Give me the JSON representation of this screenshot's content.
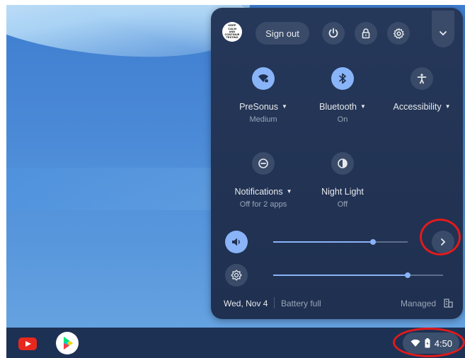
{
  "system_tray": {
    "avatar_text": [
      "KEEP",
      "CALM",
      "AND",
      "CONTINUE",
      "TESTING"
    ],
    "sign_out_label": "Sign out",
    "tiles": [
      {
        "label": "PreSonus",
        "sublabel": "Medium",
        "icon": "wifi-lock-icon",
        "active": true,
        "has_menu": true
      },
      {
        "label": "Bluetooth",
        "sublabel": "On",
        "icon": "bluetooth-icon",
        "active": true,
        "has_menu": true
      },
      {
        "label": "Accessibility",
        "sublabel": "",
        "icon": "accessibility-icon",
        "active": false,
        "has_menu": true
      },
      {
        "label": "Notifications",
        "sublabel": "Off for 2 apps",
        "icon": "do-not-disturb-icon",
        "active": false,
        "has_menu": true
      },
      {
        "label": "Night Light",
        "sublabel": "Off",
        "icon": "night-light-icon",
        "active": false,
        "has_menu": false
      }
    ],
    "volume_level": 0.74,
    "brightness_level": 0.79,
    "date": "Wed, Nov 4",
    "battery_status": "Battery full",
    "managed_label": "Managed"
  },
  "shelf": {
    "apps": [
      "youtube-icon",
      "play-store-icon"
    ],
    "time": "4:50"
  },
  "colors": {
    "panel_bg": "#223354",
    "accent": "#8ab4f8",
    "highlight_ring": "#e11b1b",
    "shelf_bg": "#1d3154"
  }
}
